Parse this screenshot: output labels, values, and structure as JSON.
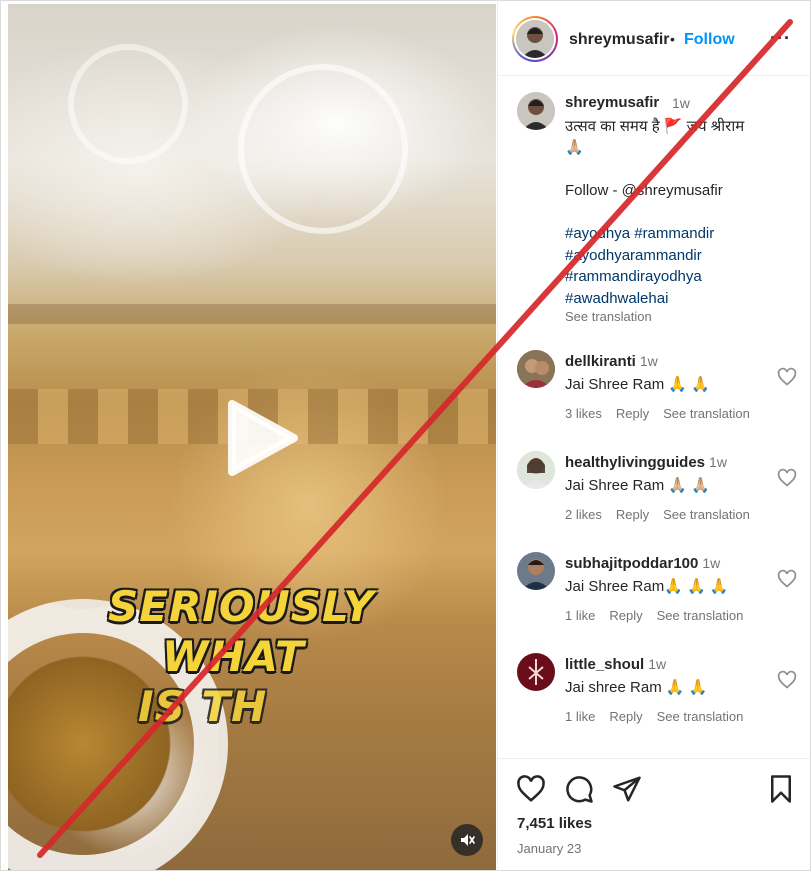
{
  "post": {
    "username": "shreymusafir",
    "dot": "•",
    "follow_label": "Follow",
    "more_label": "···"
  },
  "video": {
    "overlay_lines": [
      "SERIOUSLY",
      "WHAT",
      "IS TH"
    ]
  },
  "caption": {
    "username": "shreymusafir",
    "time": "1w",
    "line1": "उत्सव का समय है 🚩 जय श्रीराम",
    "line2": "🙏🏼",
    "follow_line": "Follow - @shreymusafir",
    "hashtags": [
      "#ayodhya #rammandir",
      "#ayodhyarammandir",
      "#rammandirayodhya",
      "#awadhwalehai"
    ],
    "see_translation": "See translation"
  },
  "comments": [
    {
      "username": "dellkiranti",
      "time": "1w",
      "text": "Jai Shree Ram 🙏 🙏",
      "likes": "3 likes",
      "reply": "Reply",
      "translate": "See translation",
      "avatar_color": "#7d6a52"
    },
    {
      "username": "healthylivingguides",
      "time": "1w",
      "text": "Jai Shree Ram 🙏🏼 🙏🏼",
      "likes": "2 likes",
      "reply": "Reply",
      "translate": "See translation",
      "avatar_color": "#5f7c62"
    },
    {
      "username": "subhajitpoddar100",
      "time": "1w",
      "text": "Jai Shree Ram🙏 🙏 🙏",
      "likes": "1 like",
      "reply": "Reply",
      "translate": "See translation",
      "avatar_color": "#3c4a5a"
    },
    {
      "username": "little_shoul",
      "time": "1w",
      "text": "Jai shree Ram 🙏 🙏",
      "likes": "1 like",
      "reply": "Reply",
      "translate": "See translation",
      "avatar_color": "#7a1020"
    }
  ],
  "footer": {
    "likes": "7,451 likes",
    "date": "January 23"
  },
  "colors": {
    "accent_blue": "#0095f6",
    "hashtag_blue": "#00376b",
    "strike_red": "#d6282b",
    "overlay_yellow": "#f5d33a"
  },
  "icons": {
    "heart": "heart-icon",
    "comment": "comment-icon",
    "share": "share-icon",
    "save": "bookmark-icon",
    "play": "play-icon",
    "mute": "mute-icon"
  }
}
